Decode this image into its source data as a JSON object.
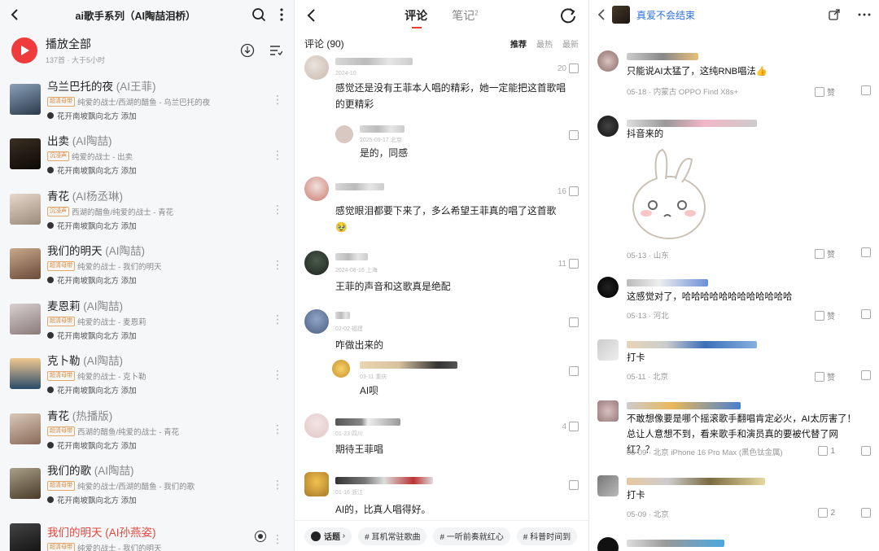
{
  "left": {
    "title": "ai歌手系列（AI陶喆泪桥）",
    "play_all": "播放全部",
    "meta": "137首 · 大于5小时",
    "songs": [
      {
        "name": "乌兰巴托的夜",
        "alt": "(AI王菲)",
        "badge": "超清母带",
        "sub": "纯爱的战士/西湖的醋鱼 - 乌兰巴托的夜",
        "adder": "花开南坡飘向北方 添加"
      },
      {
        "name": "出卖",
        "alt": "(AI陶喆)",
        "badge": "沉浸声",
        "sub": "纯爱的战士 - 出卖",
        "adder": "花开南坡飘向北方 添加"
      },
      {
        "name": "青花",
        "alt": "(AI杨丞琳)",
        "badge": "沉浸声",
        "sub": "西湖的醋鱼/纯爱的战士 - 青花",
        "adder": "花开南坡飘向北方 添加"
      },
      {
        "name": "我们的明天",
        "alt": "(AI陶喆)",
        "badge": "超清母带",
        "sub": "纯爱的战士 - 我们的明天",
        "adder": "花开南坡飘向北方 添加"
      },
      {
        "name": "麦恩莉",
        "alt": "(AI陶喆)",
        "badge": "超清母带",
        "sub": "纯爱的战士 - 麦恩莉",
        "adder": "花开南坡飘向北方 添加"
      },
      {
        "name": "克卜勒",
        "alt": "(AI陶喆)",
        "badge": "超清母带",
        "sub": "纯爱的战士 - 克卜勒",
        "adder": "花开南坡飘向北方 添加"
      },
      {
        "name": "青花",
        "alt": "(热播版)",
        "badge": "超清母带",
        "sub": "西湖的醋鱼/纯爱的战士 - 青花",
        "adder": "花开南坡飘向北方 添加"
      },
      {
        "name": "我们的歌",
        "alt": "(AI陶喆)",
        "badge": "超清母带",
        "sub": "纯爱的战士/西湖的醋鱼 - 我们的歌",
        "adder": "花开南坡飘向北方 添加"
      },
      {
        "name": "我们的明天",
        "alt": "(AI孙燕姿)",
        "badge": "超清母带",
        "sub": "纯爱的战士 - 我们的明天",
        "adder": ""
      }
    ]
  },
  "mid": {
    "tab_comments": "评论",
    "tab_notes": "笔记",
    "notes_count": "2",
    "comments_header": "评论 (90)",
    "sort_recommend": "推荐",
    "sort_hot": "最热",
    "sort_new": "最新",
    "comments": [
      {
        "time": "2024-10",
        "likes": "20",
        "text": "感觉还是没有王菲本人唱的精彩，她一定能把这首歌唱的更精彩"
      },
      {
        "time": "2025-09-17 北京",
        "likes": "",
        "text": "是的，同感"
      },
      {
        "time": "",
        "likes": "16",
        "text": "感觉眼泪都要下来了，多么希望王菲真的唱了这首歌 🥹"
      },
      {
        "time": "2024-08-16 上海",
        "likes": "11",
        "text": "王菲的声音和这歌真是绝配"
      },
      {
        "time": "02-02 福建",
        "likes": "",
        "text": "咋做出来的"
      },
      {
        "time": "03-11 重庆",
        "likes": "",
        "text": "AI呗"
      },
      {
        "time": "01-23 四川",
        "likes": "4",
        "text": "期待王菲唱"
      },
      {
        "time": "01-16 浙江",
        "likes": "",
        "text": "AI的，比真人唱得好。"
      }
    ],
    "topics": [
      "话题",
      "# 耳机常驻歌曲",
      "# 一听前奏就红心",
      "# 科普时间到"
    ]
  },
  "right": {
    "title": "真爱不会结束",
    "comments": [
      {
        "text": "只能说AI太猛了，这纯RNB唱法👍",
        "meta": "05-18 · 内蒙古   OPPO Find X8s+",
        "zan": "赞"
      },
      {
        "text": "抖音来的",
        "meta": "05-13 · 山东",
        "zan": "赞"
      },
      {
        "text": "这感觉对了，哈哈哈哈哈哈哈哈哈哈哈哈",
        "meta": "05-13 · 河北",
        "zan": "赞"
      },
      {
        "text": "打卡",
        "meta": "05-11 · 北京",
        "zan": "赞"
      },
      {
        "text": "不敢想像要是哪个摇滚歌手翻唱肯定必火，AI太厉害了！总让人意想不到，看来歌手和演员真的要被代替了网红？？",
        "meta": "05-09 · 北京   iPhone 16 Pro Max (黑色钛金属)",
        "zan": "1"
      },
      {
        "text": "打卡",
        "meta": "05-09 · 北京",
        "zan": "2"
      }
    ]
  }
}
